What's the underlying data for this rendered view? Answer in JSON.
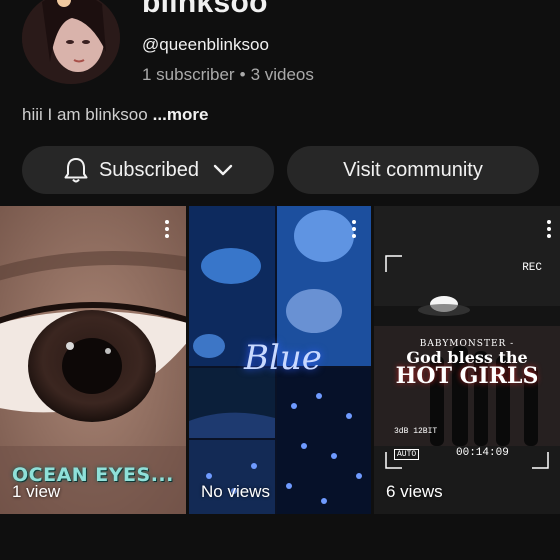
{
  "channel": {
    "name": "blinksoo",
    "handle": "@queenblinksoo",
    "subscriber_count": "1 subscriber",
    "separator": "•",
    "video_count": "3 videos",
    "bio": "hiii I am blinksoo",
    "bio_more": "...more"
  },
  "actions": {
    "subscribed_label": "Subscribed",
    "community_label": "Visit community"
  },
  "shorts": [
    {
      "overlay_text": "OCEAN EYES...",
      "views": "1 view",
      "menu_icon": "more-vertical-icon"
    },
    {
      "overlay_text": "Blue",
      "views": "No views",
      "menu_icon": "more-vertical-icon"
    },
    {
      "band_text": "BABYMONSTER -",
      "line1": "God bless the",
      "line2": "HOT GIRLS",
      "rec": "REC",
      "cam_info": "3dB 12BIT",
      "auto": "AUTO",
      "timecode": "00:14:09",
      "views": "6 views",
      "menu_icon": "more-vertical-icon"
    }
  ],
  "icons": {
    "bell": "bell-icon",
    "chevron": "chevron-down-icon"
  },
  "colors": {
    "background": "#0f0f0f",
    "button": "#272727",
    "secondary_text": "#aaaaaa"
  }
}
